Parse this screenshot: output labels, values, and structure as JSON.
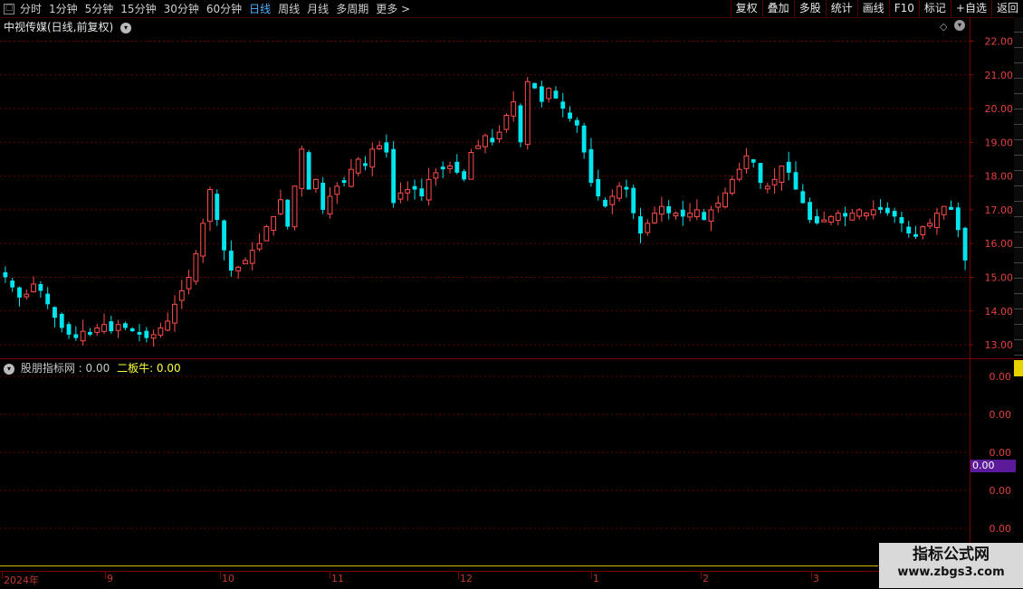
{
  "toolbar": {
    "periods": [
      "分时",
      "1分钟",
      "5分钟",
      "15分钟",
      "30分钟",
      "60分钟",
      "日线",
      "周线",
      "月线",
      "多周期",
      "更多 >"
    ],
    "active_period": "日线",
    "right_buttons": [
      "复权",
      "叠加",
      "多股",
      "统计",
      "画线",
      "F10",
      "标记",
      "+自选",
      "返回"
    ]
  },
  "stock": {
    "title": "中视传媒(日线,前复权)"
  },
  "indicator": {
    "name": "股朋指标网",
    "value_text": ": 0.00",
    "line2": "二板牛: 0.00",
    "marker_value": "0.00"
  },
  "colors": {
    "up": "#ff4d4d",
    "down": "#00e5ee",
    "grid": "#6a0000",
    "axis_text": "#e04040",
    "indicator_line": "#ffff3c"
  },
  "price_axis_labels": [
    "22.00",
    "21.00",
    "20.00",
    "19.00",
    "18.00",
    "17.00",
    "16.00",
    "15.00",
    "14.00",
    "13.00"
  ],
  "indicator_axis_labels": [
    "0.00",
    "0.00",
    "0.00",
    "0.00",
    "0.00"
  ],
  "date_labels": [
    "2024年",
    "9",
    "10",
    "11",
    "12",
    "1",
    "2",
    "3"
  ],
  "watermark": {
    "line1": "指标公式网",
    "line2": "www.zbgs3.com"
  },
  "chart_data": {
    "type": "candlestick",
    "ylim": [
      12.6,
      22.2
    ],
    "closes": [
      15.0,
      14.7,
      14.4,
      14.5,
      14.8,
      14.6,
      14.2,
      13.8,
      13.5,
      13.3,
      13.2,
      13.4,
      13.3,
      13.5,
      13.6,
      13.4,
      13.6,
      13.5,
      13.4,
      13.3,
      13.2,
      13.3,
      13.5,
      13.7,
      14.2,
      14.6,
      15.0,
      15.7,
      16.6,
      17.6,
      16.7,
      15.8,
      15.2,
      15.3,
      15.5,
      15.8,
      16.0,
      16.5,
      16.8,
      17.3,
      16.5,
      17.7,
      18.8,
      17.6,
      17.9,
      17.0,
      17.4,
      17.7,
      17.8,
      18.2,
      18.5,
      18.3,
      18.8,
      18.9,
      18.7,
      17.2,
      17.5,
      17.6,
      17.6,
      17.4,
      17.9,
      18.1,
      18.2,
      18.3,
      18.1,
      17.9,
      18.7,
      18.9,
      19.2,
      19.0,
      19.3,
      19.8,
      20.2,
      19.0,
      20.8,
      20.6,
      20.2,
      20.6,
      20.3,
      20.0,
      19.7,
      19.5,
      18.7,
      17.8,
      17.4,
      17.1,
      17.4,
      17.7,
      17.6,
      16.9,
      16.3,
      16.6,
      16.9,
      17.1,
      16.9,
      16.9,
      16.8,
      16.9,
      17.0,
      16.7,
      17.0,
      17.2,
      17.5,
      17.9,
      18.2,
      18.6,
      18.4,
      17.8,
      17.7,
      17.9,
      18.3,
      18.1,
      17.6,
      17.2,
      16.7,
      16.6,
      16.7,
      16.8,
      16.9,
      16.8,
      16.9,
      17.0,
      16.9,
      17.0,
      17.0,
      16.9,
      16.8,
      16.6,
      16.3,
      16.2,
      16.5,
      16.6,
      16.9,
      17.1,
      17.0,
      16.4,
      15.5
    ],
    "series": [
      {
        "name": "二板牛",
        "values": [
          0.0
        ]
      }
    ]
  }
}
